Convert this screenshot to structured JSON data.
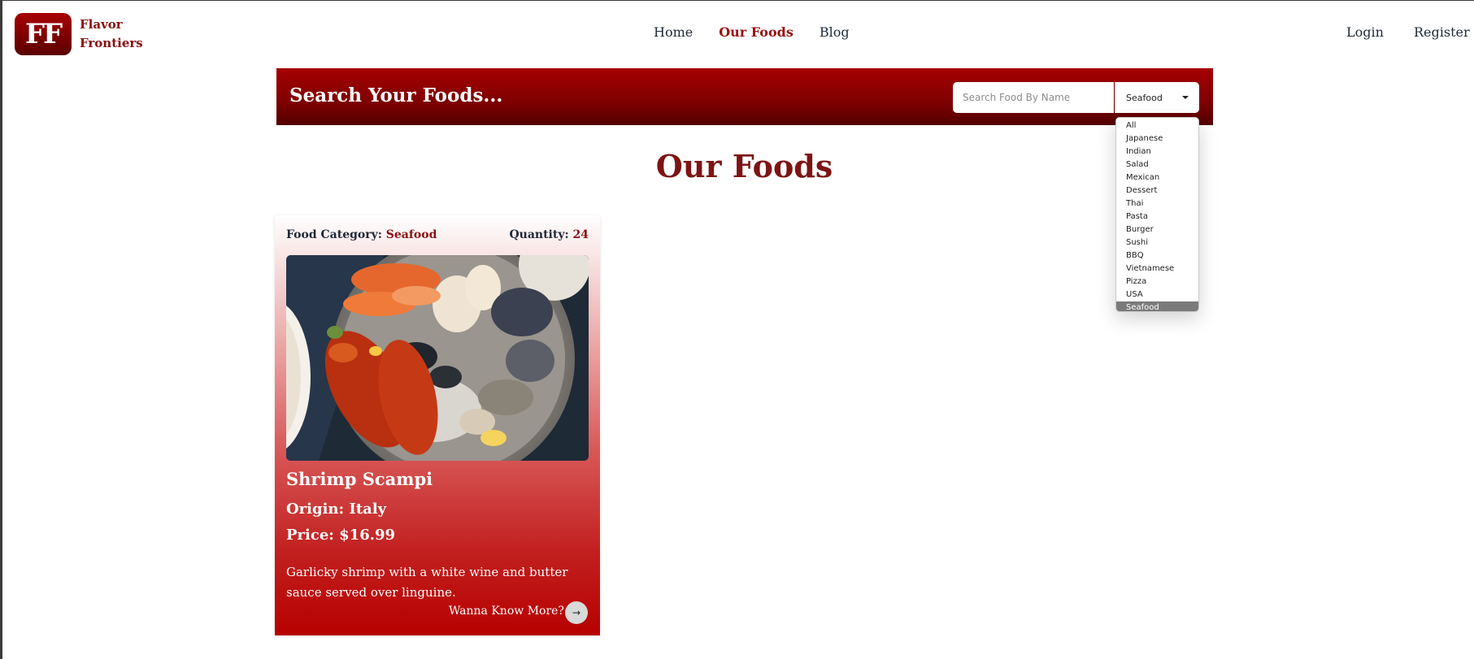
{
  "brand": {
    "logo_mark": "FF",
    "name_line1": "Flavor",
    "name_line2": "Frontiers"
  },
  "nav": {
    "home": "Home",
    "our_foods": "Our Foods",
    "blog": "Blog",
    "login": "Login",
    "register": "Register"
  },
  "search": {
    "title": "Search Your Foods...",
    "placeholder": "Search Food By Name",
    "selected_category": "Seafood",
    "options": [
      "All",
      "Japanese",
      "Indian",
      "Salad",
      "Mexican",
      "Dessert",
      "Thai",
      "Pasta",
      "Burger",
      "Sushi",
      "BBQ",
      "Vietnamese",
      "Pizza",
      "USA",
      "Seafood"
    ]
  },
  "page": {
    "title": "Our Foods"
  },
  "card": {
    "category_label": "Food Category:",
    "category_value": "Seafood",
    "quantity_label": "Quantity:",
    "quantity_value": "24",
    "title": "Shrimp Scampi",
    "origin": "Origin: Italy",
    "price": "Price: $16.99",
    "description": "Garlicky shrimp with a white wine and butter sauce served over linguine.",
    "more_label": "Wanna Know More?",
    "more_icon": "arrow-right-icon"
  },
  "colors": {
    "brand_red": "#9b1111",
    "banner_top": "#a50000",
    "banner_bottom": "#520000",
    "card_bottom": "#b70000"
  }
}
